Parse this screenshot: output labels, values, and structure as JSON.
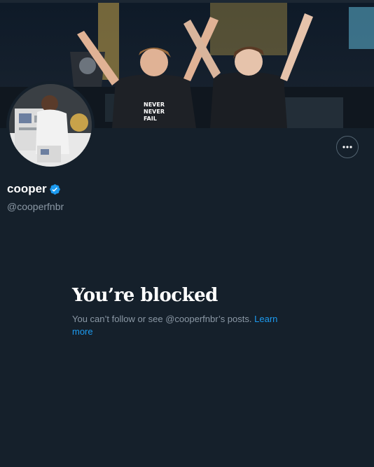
{
  "profile": {
    "display_name": "cooper",
    "handle": "@cooperfnbr",
    "verified": true
  },
  "icons": {
    "verified": "verified-badge-icon",
    "more": "more-horizontal-icon"
  },
  "banner": {
    "shirt_text": [
      "NEVER",
      "NEVER",
      "FAIL"
    ]
  },
  "blocked": {
    "title": "You’re blocked",
    "description": "You can’t follow or see @cooperfnbr’s posts.",
    "learn_more": "Learn more"
  },
  "colors": {
    "background": "#15202b",
    "accent": "#1d9bf0",
    "secondary_text": "#8b98a5"
  }
}
